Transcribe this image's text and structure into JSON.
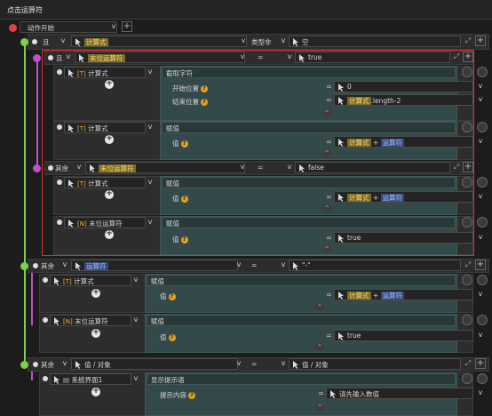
{
  "window_title": "点击运算符",
  "root": {
    "label": "动作开始"
  },
  "blocks": {
    "and_top": {
      "label": "且",
      "expr": "计算式",
      "op": "类型非",
      "value": "空"
    },
    "and_inner": {
      "label": "且",
      "expr": "末位运算符",
      "op": "=",
      "value": "true"
    },
    "calc1": {
      "type_tag": "[T]",
      "name": "计算式",
      "action": "截取字符",
      "params": [
        {
          "label": "开始位置",
          "value": "0"
        },
        {
          "label": "结束位置",
          "value_hl": "计算式",
          "value_rest": ".length-2"
        }
      ]
    },
    "calc2": {
      "type_tag": "[T]",
      "name": "计算式",
      "action": "赋值",
      "params": [
        {
          "label": "值",
          "value_hl": "计算式",
          "value_rest": " + ",
          "value_hl2": "运算符"
        }
      ]
    },
    "else1": {
      "label": "其余",
      "expr": "末位运算符",
      "op": "=",
      "value": "false"
    },
    "calc3": {
      "type_tag": "[T]",
      "name": "计算式",
      "action": "赋值",
      "params": [
        {
          "label": "值",
          "value_hl": "计算式",
          "value_rest": " + ",
          "value_hl2": "运算符"
        }
      ]
    },
    "last1": {
      "type_tag": "[N]",
      "name": "末位运算符",
      "action": "赋值",
      "params": [
        {
          "label": "值",
          "value": "true"
        }
      ]
    },
    "else2": {
      "label": "其余",
      "expr": "运算符",
      "op": "=",
      "value": "\"-\""
    },
    "calc4": {
      "type_tag": "[T]",
      "name": "计算式",
      "action": "赋值",
      "params": [
        {
          "label": "值",
          "value_hl": "计算式",
          "value_rest": " + ",
          "value_hl2": "运算符"
        }
      ]
    },
    "last2": {
      "type_tag": "[N]",
      "name": "末位运算符",
      "action": "赋值",
      "params": [
        {
          "label": "值",
          "value": "true"
        }
      ]
    },
    "else3": {
      "label": "其余",
      "expr": "值 / 对象",
      "op": "=",
      "value": "值 / 对象"
    },
    "sys": {
      "name": "系统界面1",
      "action": "显示提示语",
      "params": [
        {
          "label": "提示内容",
          "value": "请先输入数值"
        }
      ]
    }
  },
  "glyphs": {
    "cursor": "▸",
    "dropdown": "v",
    "plus": "+",
    "eq": "="
  }
}
